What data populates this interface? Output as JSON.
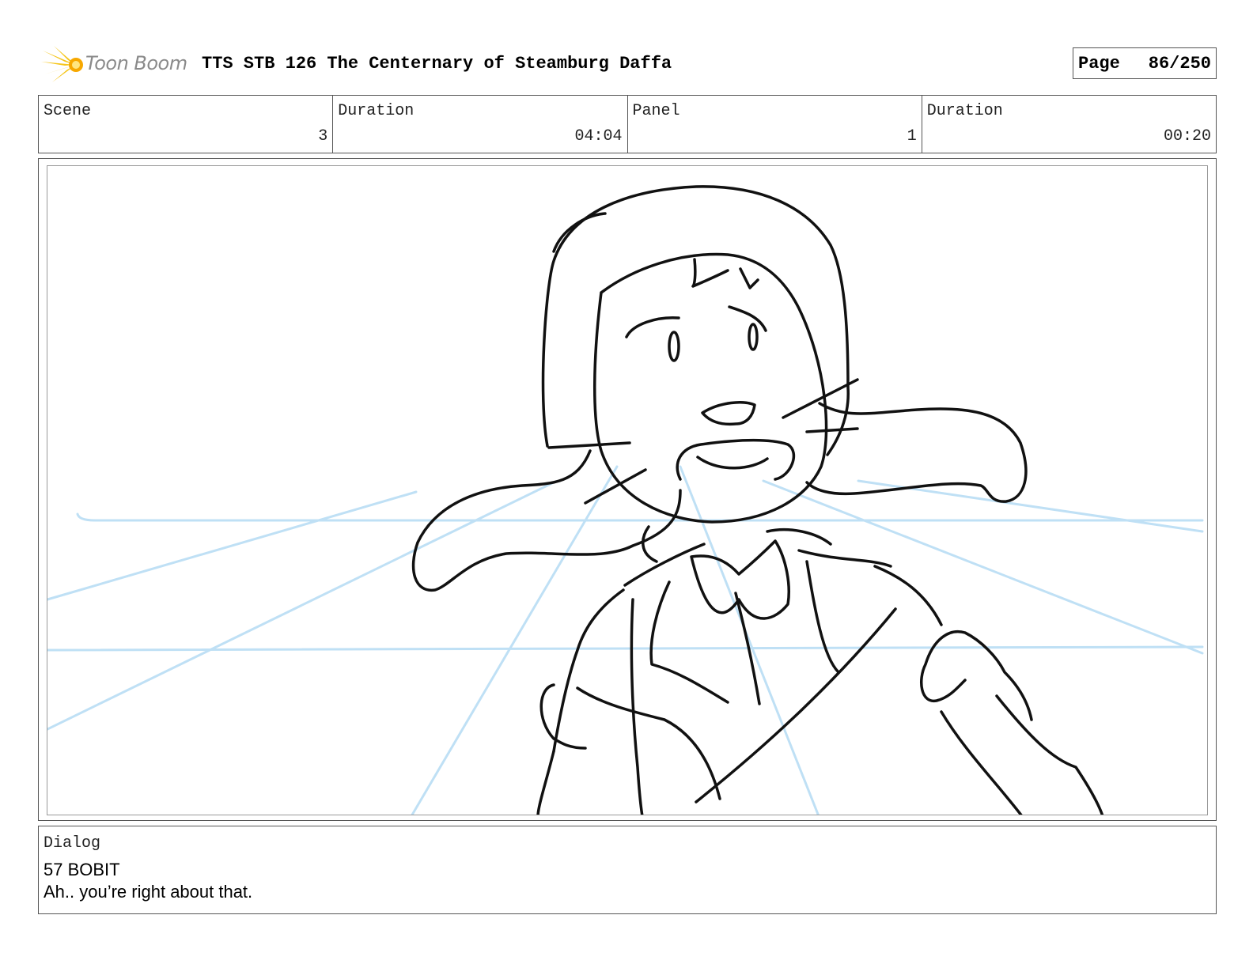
{
  "header": {
    "logo_text": "Toon Boom",
    "title": "TTS STB 126 The Centernary of Steamburg Daffa",
    "page_label": "Page",
    "page_value": "86/250"
  },
  "info": {
    "scene_label": "Scene",
    "scene_value": "3",
    "scene_duration_label": "Duration",
    "scene_duration_value": "04:04",
    "panel_label": "Panel",
    "panel_value": "1",
    "panel_duration_label": "Duration",
    "panel_duration_value": "00:20"
  },
  "panel": {
    "guide_color": "#bfe0f5",
    "line_color": "#111111"
  },
  "dialog": {
    "label": "Dialog",
    "speaker": "57 BOBIT",
    "line": "Ah.. you’re right about that."
  },
  "colors": {
    "logo_accent": "#f5c518",
    "border": "#555555"
  }
}
